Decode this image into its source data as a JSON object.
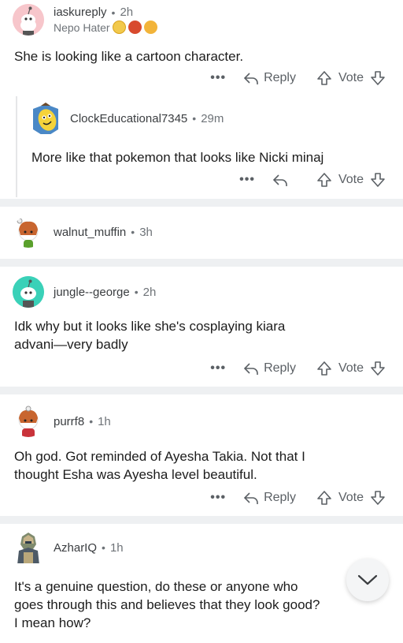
{
  "comments": [
    {
      "username": "iaskureply",
      "time": "2h",
      "flair": "Nepo Hater",
      "text": "She is looking like a cartoon character.",
      "reply_label": "Reply",
      "vote_label": "Vote"
    },
    {
      "username": "ClockEducational7345",
      "time": "29m",
      "text": "More like that pokemon that looks like Nicki minaj",
      "vote_label": "Vote"
    },
    {
      "username": "walnut_muffin",
      "time": "3h"
    },
    {
      "username": "jungle--george",
      "time": "2h",
      "text_line1": "Idk why but it looks like she's cosplaying kiara",
      "text_line2": "advani—very badly",
      "reply_label": "Reply",
      "vote_label": "Vote"
    },
    {
      "username": "purrf8",
      "time": "1h",
      "text_line1": "Oh god. Got reminded of Ayesha Takia. Not that I",
      "text_line2": "thought Esha was Ayesha level beautiful.",
      "reply_label": "Reply",
      "vote_label": "Vote"
    },
    {
      "username": "AzharIQ",
      "time": "1h",
      "text_line1": "It's a genuine question, do these or anyone who",
      "text_line2": "goes through this and believes that they look good?",
      "text_line3": "I mean how?"
    }
  ],
  "separator_dot": "•",
  "more_glyph": "•••",
  "colors": {
    "separator": "#eef0f2",
    "text": "#1c1c1c",
    "muted": "#6e7378"
  },
  "icons": [
    "reply-arrow-icon",
    "upvote-arrow-icon",
    "downvote-arrow-icon",
    "more-options-icon",
    "chevron-down-icon"
  ]
}
